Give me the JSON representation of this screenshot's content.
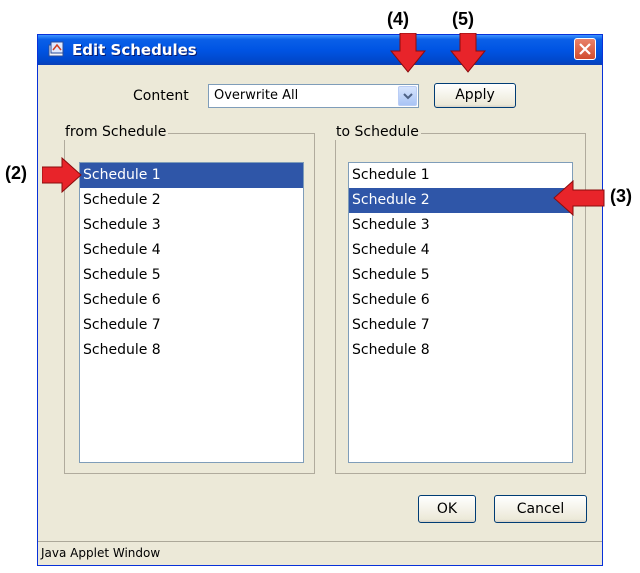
{
  "window": {
    "title": "Edit Schedules",
    "status": "Java Applet Window"
  },
  "content_row": {
    "label": "Content",
    "selected": "Overwrite All",
    "apply_label": "Apply"
  },
  "from_group": {
    "label": "from Schedule",
    "items": [
      "Schedule 1",
      "Schedule 2",
      "Schedule 3",
      "Schedule 4",
      "Schedule 5",
      "Schedule 6",
      "Schedule 7",
      "Schedule 8"
    ],
    "selected_index": 0
  },
  "to_group": {
    "label": "to Schedule",
    "items": [
      "Schedule 1",
      "Schedule 2",
      "Schedule 3",
      "Schedule 4",
      "Schedule 5",
      "Schedule 6",
      "Schedule 7",
      "Schedule 8"
    ],
    "selected_index": 1
  },
  "buttons": {
    "ok": "OK",
    "cancel": "Cancel"
  },
  "callouts": {
    "c2": "(2)",
    "c3": "(3)",
    "c4": "(4)",
    "c5": "(5)"
  },
  "colors": {
    "arrow": "#e8242a",
    "selection": "#2f56a8",
    "titlebar": "#0054e3"
  }
}
